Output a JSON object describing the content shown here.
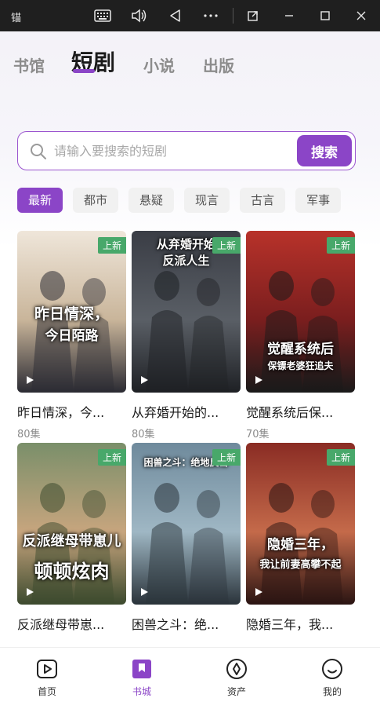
{
  "window": {
    "title": "锚"
  },
  "top_tabs": [
    {
      "label": "书馆"
    },
    {
      "label": "短剧"
    },
    {
      "label": "小说"
    },
    {
      "label": "出版"
    }
  ],
  "search": {
    "placeholder": "请输入要搜索的短剧",
    "button_label": "搜索"
  },
  "categories": [
    "最新",
    "都市",
    "悬疑",
    "现言",
    "古言",
    "军事"
  ],
  "dramas": [
    {
      "title": "昨日情深，今...",
      "count": "80集",
      "badge": "上新",
      "poster_text": [
        "昨日情深，",
        "今日陌路"
      ],
      "colors": [
        "#efe6da",
        "#c9b59a",
        "#2b2b33"
      ]
    },
    {
      "title": "从弃婚开始的...",
      "count": "80集",
      "badge": "上新",
      "poster_text": [
        "从弃婚开始",
        "反派人生"
      ],
      "colors": [
        "#3a3d45",
        "#5a5f66",
        "#1e2024"
      ]
    },
    {
      "title": "觉醒系统后保...",
      "count": "70集",
      "badge": "上新",
      "poster_text": [
        "觉醒系统后",
        "保镖老婆狂追夫"
      ],
      "colors": [
        "#b8322a",
        "#7a1e1e",
        "#1a1a1a"
      ]
    },
    {
      "title": "反派继母带崽...",
      "count": "",
      "badge": "上新",
      "poster_text": [
        "反派继母带崽儿",
        "顿顿炫肉"
      ],
      "colors": [
        "#7a8f6a",
        "#c7a57e",
        "#3c4a2e"
      ]
    },
    {
      "title": "困兽之斗：绝...",
      "count": "",
      "badge": "上新",
      "poster_text": [
        "困兽之斗：绝地反击"
      ],
      "colors": [
        "#6f8a9c",
        "#9fb7c4",
        "#2a333a"
      ]
    },
    {
      "title": "隐婚三年，我...",
      "count": "",
      "badge": "上新",
      "poster_text": [
        "隐婚三年，",
        "我让前妻高攀不起"
      ],
      "colors": [
        "#8a2c24",
        "#c46a4a",
        "#2a1412"
      ]
    }
  ],
  "bottom_nav": [
    {
      "label": "首页",
      "icon": "play-square-icon"
    },
    {
      "label": "书城",
      "icon": "bookmark-icon"
    },
    {
      "label": "资产",
      "icon": "compass-icon"
    },
    {
      "label": "我的",
      "icon": "smile-icon"
    }
  ],
  "colors": {
    "accent": "#8b45c7",
    "badge": "#48a86a"
  }
}
